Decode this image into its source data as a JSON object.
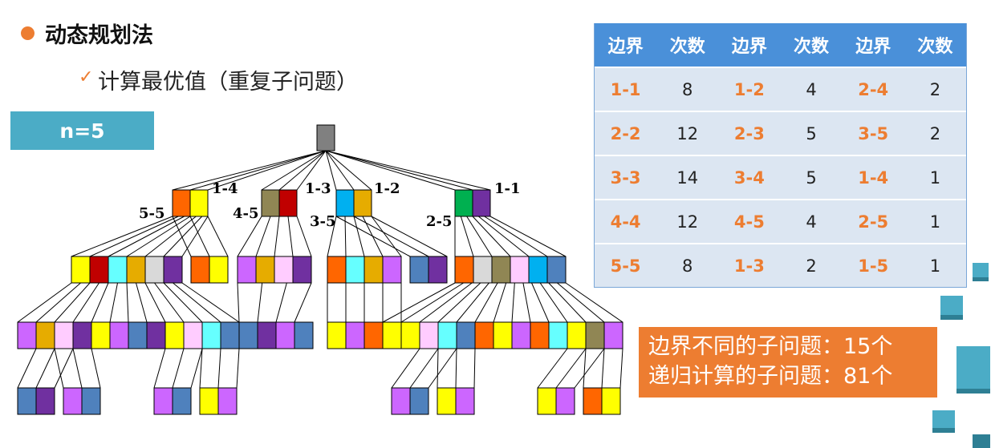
{
  "heading": "动态规划法",
  "sub_bullet": "计算最优值（重复子问题）",
  "check_icon": "checkmark-icon",
  "n_label": "n=5",
  "table": {
    "headers": [
      "边界",
      "次数",
      "边界",
      "次数",
      "边界",
      "次数"
    ],
    "rows": [
      [
        "1-1",
        "8",
        "1-2",
        "4",
        "2-4",
        "2"
      ],
      [
        "2-2",
        "12",
        "2-3",
        "5",
        "3-5",
        "2"
      ],
      [
        "3-3",
        "14",
        "3-4",
        "5",
        "1-4",
        "1"
      ],
      [
        "4-4",
        "12",
        "4-5",
        "4",
        "2-5",
        "1"
      ],
      [
        "5-5",
        "8",
        "1-3",
        "2",
        "1-5",
        "1"
      ]
    ]
  },
  "note": {
    "line1": "边界不同的子问题：15个",
    "line2": "递归计算的子问题：81个"
  },
  "tree_labels": {
    "n1_right": "1-4",
    "n1_left": "5-5",
    "n2_right": "1-3",
    "n2_left": "4-5",
    "n3_right": "1-2",
    "n3_left": "3-5",
    "n4_right": "1-1",
    "n4_left": "2-5"
  },
  "colors": {
    "orange": "#ED7D31",
    "teal": "#4BACC6",
    "table_header": "#4A90D9",
    "table_body": "#DCE6F2"
  }
}
